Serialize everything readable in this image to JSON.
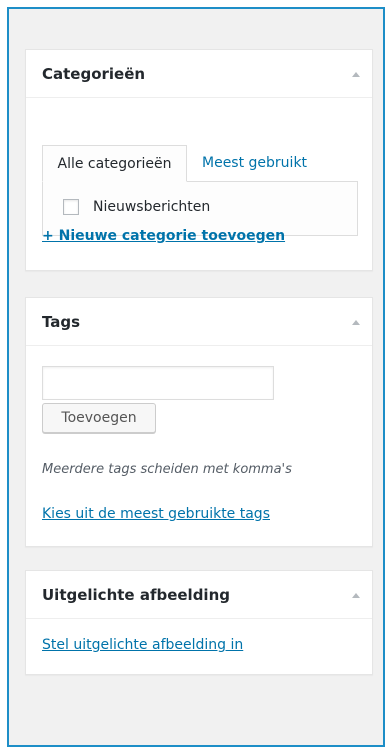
{
  "categories": {
    "title": "Categorieën",
    "tab_all": "Alle categorieën",
    "tab_most_used": "Meest gebruikt",
    "items": [
      {
        "label": "Nieuwsberichten",
        "checked": false
      }
    ],
    "add_link": "+ Nieuwe categorie toevoegen"
  },
  "tags": {
    "title": "Tags",
    "input_value": "",
    "input_placeholder": "",
    "add_button": "Toevoegen",
    "hint": "Meerdere tags scheiden met komma's",
    "choose_link": "Kies uit de meest gebruikte tags"
  },
  "featured_image": {
    "title": "Uitgelichte afbeelding",
    "set_link": "Stel uitgelichte afbeelding in"
  },
  "colors": {
    "frame_border": "#1d8ec7",
    "link": "#0073aa",
    "background": "#f1f1f1"
  }
}
